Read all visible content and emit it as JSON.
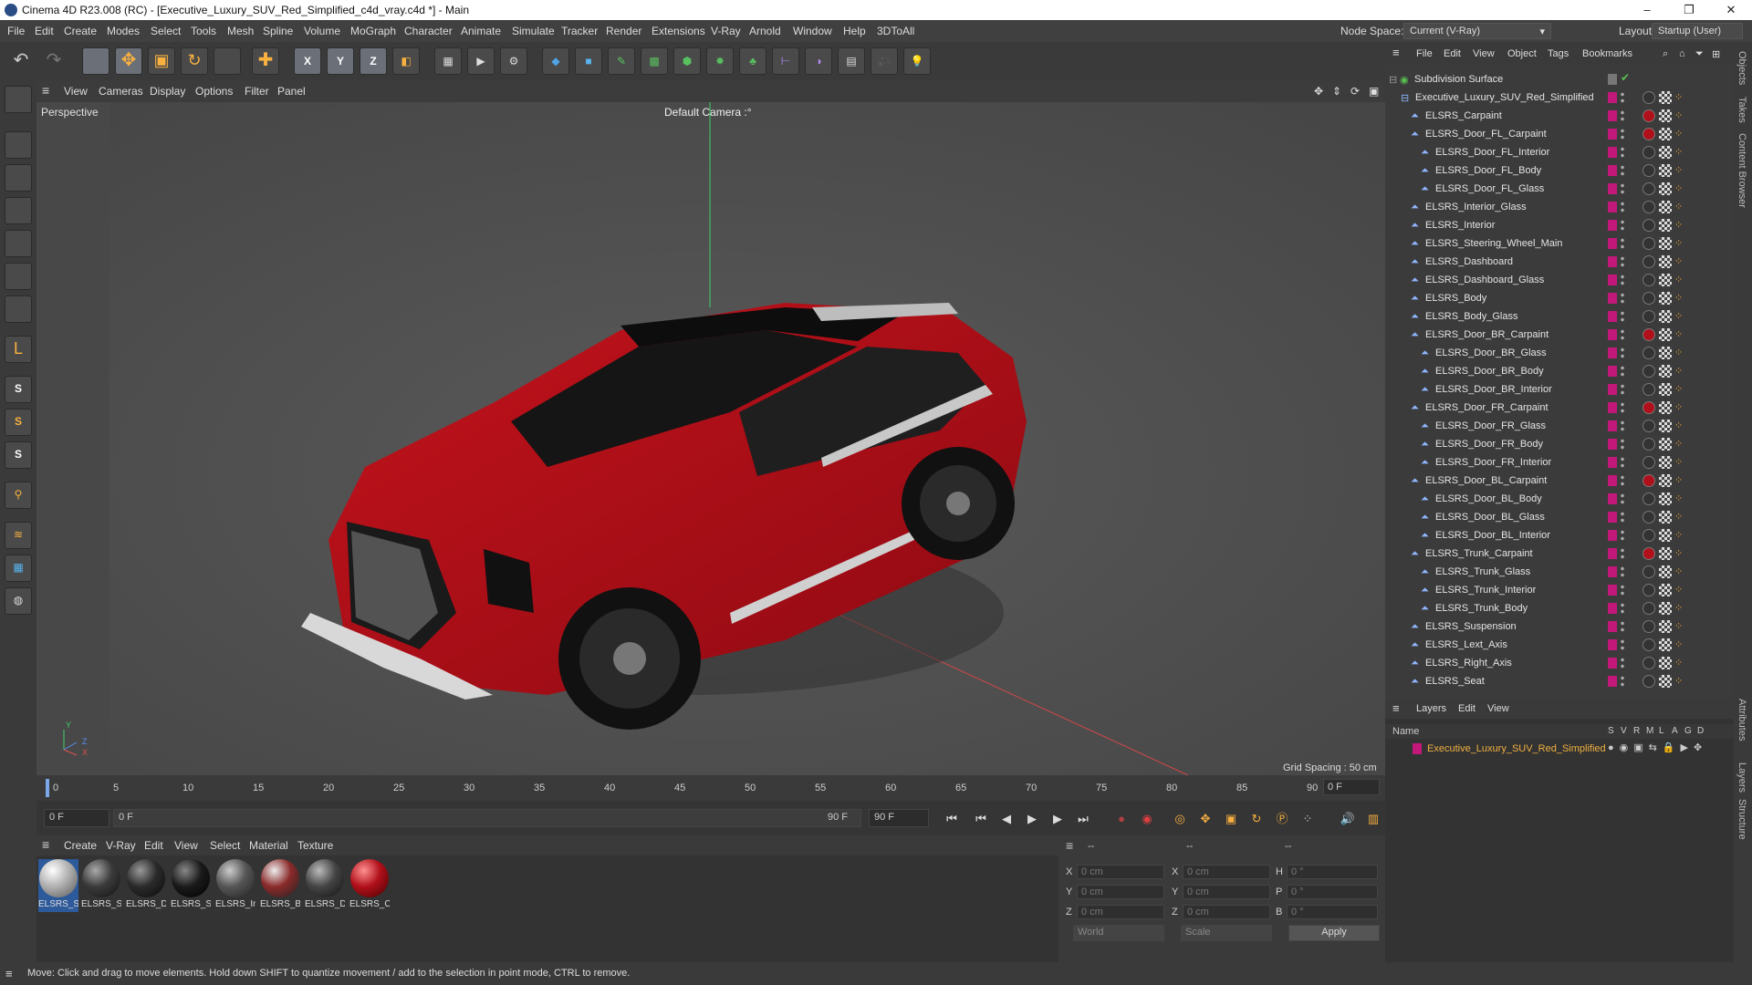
{
  "window": {
    "title": "Cinema 4D R23.008 (RC) - [Executive_Luxury_SUV_Red_Simplified_c4d_vray.c4d *] - Main",
    "controls": [
      "–",
      "❐",
      "✕"
    ]
  },
  "menubar": {
    "items": [
      "File",
      "Edit",
      "Create",
      "Modes",
      "Select",
      "Tools",
      "Mesh",
      "Spline",
      "Volume",
      "MoGraph",
      "Character",
      "Animate",
      "Simulate",
      "Tracker",
      "Render",
      "Extensions",
      "V-Ray",
      "Arnold",
      "Window",
      "Help",
      "3DToAll"
    ],
    "node_space_label": "Node Space:",
    "node_space_value": "Current (V-Ray)",
    "layout_label": "Layout:",
    "layout_value": "Startup (User)"
  },
  "viewport": {
    "menu": [
      "View",
      "Cameras",
      "Display",
      "Options",
      "Filter",
      "Panel"
    ],
    "label": "Perspective",
    "camera": "Default Camera :°",
    "grid_spacing": "Grid Spacing : 50 cm",
    "axis_y": "Y",
    "axis_z": "Z",
    "axis_x": "X"
  },
  "timeline": {
    "ticks": [
      "0",
      "5",
      "10",
      "15",
      "20",
      "25",
      "30",
      "35",
      "40",
      "45",
      "50",
      "55",
      "60",
      "65",
      "70",
      "75",
      "80",
      "85",
      "90"
    ],
    "frame_end_field": "0 F"
  },
  "transport": {
    "current_frame": "0 F",
    "start_frame": "0 F",
    "end_frame": "90 F",
    "end_frame2": "90 F"
  },
  "materials": {
    "menu": [
      "Create",
      "V-Ray",
      "Edit",
      "View",
      "Select",
      "Material",
      "Texture"
    ],
    "items": [
      {
        "name": "ELSRS_S",
        "color": "#b8b8b8",
        "selected": true
      },
      {
        "name": "ELSRS_S",
        "color": "#3a3a3a",
        "selected": false
      },
      {
        "name": "ELSRS_D",
        "color": "#2a2a2a",
        "selected": false
      },
      {
        "name": "ELSRS_S",
        "color": "#1a1a1a",
        "selected": false
      },
      {
        "name": "ELSRS_Ir",
        "color": "#555555",
        "selected": false
      },
      {
        "name": "ELSRS_B",
        "color": "#8a2a2a",
        "selected": false
      },
      {
        "name": "ELSRS_D",
        "color": "#444444",
        "selected": false
      },
      {
        "name": "ELSRS_C",
        "color": "#b0101a",
        "selected": false
      }
    ]
  },
  "coords": {
    "header_dashes": [
      "--",
      "--",
      "--"
    ],
    "rows": [
      {
        "a": "X",
        "av": "0 cm",
        "b": "X",
        "bv": "0 cm",
        "c": "H",
        "cv": "0 °"
      },
      {
        "a": "Y",
        "av": "0 cm",
        "b": "Y",
        "bv": "0 cm",
        "c": "P",
        "cv": "0 °"
      },
      {
        "a": "Z",
        "av": "0 cm",
        "b": "Z",
        "bv": "0 cm",
        "c": "B",
        "cv": "0 °"
      }
    ],
    "world": "World",
    "scale": "Scale",
    "apply": "Apply"
  },
  "status": "Move: Click and drag to move elements. Hold down SHIFT to quantize movement / add to the selection in point mode, CTRL to remove.",
  "objects": {
    "menu": [
      "File",
      "Edit",
      "View",
      "Object",
      "Tags",
      "Bookmarks"
    ],
    "root": "Subdivision Surface",
    "rows": [
      {
        "name": "Executive_Luxury_SUV_Red_Simplified",
        "indent": 1
      },
      {
        "name": "ELSRS_Carpaint",
        "indent": 2
      },
      {
        "name": "ELSRS_Door_FL_Carpaint",
        "indent": 2
      },
      {
        "name": "ELSRS_Door_FL_Interior",
        "indent": 3
      },
      {
        "name": "ELSRS_Door_FL_Body",
        "indent": 3
      },
      {
        "name": "ELSRS_Door_FL_Glass",
        "indent": 3
      },
      {
        "name": "ELSRS_Interior_Glass",
        "indent": 2
      },
      {
        "name": "ELSRS_Interior",
        "indent": 2
      },
      {
        "name": "ELSRS_Steering_Wheel_Main",
        "indent": 2
      },
      {
        "name": "ELSRS_Dashboard",
        "indent": 2
      },
      {
        "name": "ELSRS_Dashboard_Glass",
        "indent": 2
      },
      {
        "name": "ELSRS_Body",
        "indent": 2
      },
      {
        "name": "ELSRS_Body_Glass",
        "indent": 2
      },
      {
        "name": "ELSRS_Door_BR_Carpaint",
        "indent": 2
      },
      {
        "name": "ELSRS_Door_BR_Glass",
        "indent": 3
      },
      {
        "name": "ELSRS_Door_BR_Body",
        "indent": 3
      },
      {
        "name": "ELSRS_Door_BR_Interior",
        "indent": 3
      },
      {
        "name": "ELSRS_Door_FR_Carpaint",
        "indent": 2
      },
      {
        "name": "ELSRS_Door_FR_Glass",
        "indent": 3
      },
      {
        "name": "ELSRS_Door_FR_Body",
        "indent": 3
      },
      {
        "name": "ELSRS_Door_FR_Interior",
        "indent": 3
      },
      {
        "name": "ELSRS_Door_BL_Carpaint",
        "indent": 2
      },
      {
        "name": "ELSRS_Door_BL_Body",
        "indent": 3
      },
      {
        "name": "ELSRS_Door_BL_Glass",
        "indent": 3
      },
      {
        "name": "ELSRS_Door_BL_Interior",
        "indent": 3
      },
      {
        "name": "ELSRS_Trunk_Carpaint",
        "indent": 2
      },
      {
        "name": "ELSRS_Trunk_Glass",
        "indent": 3
      },
      {
        "name": "ELSRS_Trunk_Interior",
        "indent": 3
      },
      {
        "name": "ELSRS_Trunk_Body",
        "indent": 3
      },
      {
        "name": "ELSRS_Suspension",
        "indent": 2
      },
      {
        "name": "ELSRS_Lext_Axis",
        "indent": 2
      },
      {
        "name": "ELSRS_Right_Axis",
        "indent": 2
      },
      {
        "name": "ELSRS_Seat",
        "indent": 2
      }
    ]
  },
  "layers": {
    "menu": [
      "Layers",
      "Edit",
      "View"
    ],
    "name_header": "Name",
    "cols": [
      "S",
      "V",
      "R",
      "M",
      "L",
      "A",
      "G",
      "D"
    ],
    "row": "Executive_Luxury_SUV_Red_Simplified"
  },
  "side_tabs": [
    "Objects",
    "Takes",
    "Content Browser",
    "Attributes",
    "Layers",
    "Structure"
  ],
  "colors": {
    "accent_red": "#b0101a",
    "layer_pink": "#c2187a",
    "selection_blue": "#2d5a9a"
  }
}
